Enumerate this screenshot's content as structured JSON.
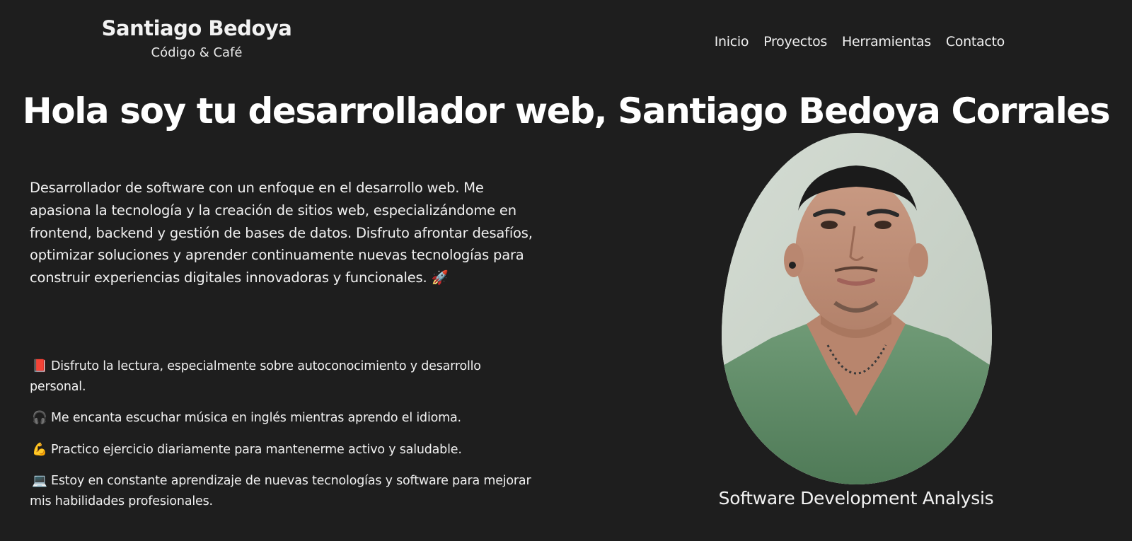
{
  "header": {
    "brand_name": "Santiago Bedoya",
    "tagline": "Código & Café",
    "nav": [
      {
        "label": "Inicio"
      },
      {
        "label": "Proyectos"
      },
      {
        "label": "Herramientas"
      },
      {
        "label": "Contacto"
      }
    ]
  },
  "hero": {
    "title": "Hola soy tu desarrollador web, Santiago Bedoya Corrales"
  },
  "about": {
    "intro": "Desarrollador de software con un enfoque en el desarrollo web. Me apasiona la tecnología y la creación de sitios web, especializándome en frontend, backend y gestión de bases de datos. Disfruto afrontar desafíos, optimizar soluciones y aprender continuamente nuevas tecnologías para construir experiencias digitales innovadoras y funcionales. 🚀",
    "hobbies": [
      {
        "emoji": "📕",
        "text": "Disfruto la lectura, especialmente sobre autoconocimiento y desarrollo personal."
      },
      {
        "emoji": "🎧",
        "text": "Me encanta escuchar música en inglés mientras aprendo el idioma."
      },
      {
        "emoji": "💪",
        "text": "Practico ejercicio diariamente para mantenerme activo y saludable."
      },
      {
        "emoji": "💻",
        "text": "Estoy en constante aprendizaje de nuevas tecnologías y software para mejorar mis habilidades profesionales."
      }
    ]
  },
  "profile": {
    "caption": "Software Development Analysis"
  },
  "colors": {
    "background": "#1e1e1e",
    "text": "#f2f2f2"
  }
}
